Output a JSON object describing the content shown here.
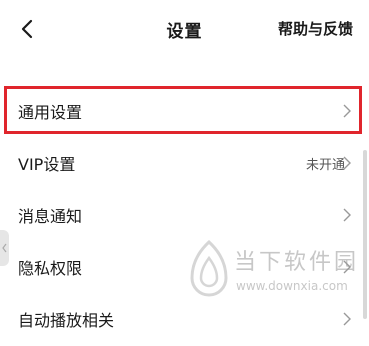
{
  "header": {
    "title": "设置",
    "help_label": "帮助与反馈"
  },
  "settings": {
    "items": [
      {
        "label": "通用设置",
        "value": ""
      },
      {
        "label": "VIP设置",
        "value": "未开通"
      },
      {
        "label": "消息通知",
        "value": ""
      },
      {
        "label": "隐私权限",
        "value": ""
      },
      {
        "label": "自动播放相关",
        "value": ""
      }
    ]
  },
  "watermark": {
    "brand": "当下软件园",
    "url": "www.downxia.com"
  },
  "colors": {
    "highlight": "#e0252c",
    "chevron": "#999999"
  },
  "icons": {
    "back": "chevron-left-icon",
    "row_arrow": "chevron-right-icon",
    "edge": "chevron-left-icon"
  }
}
